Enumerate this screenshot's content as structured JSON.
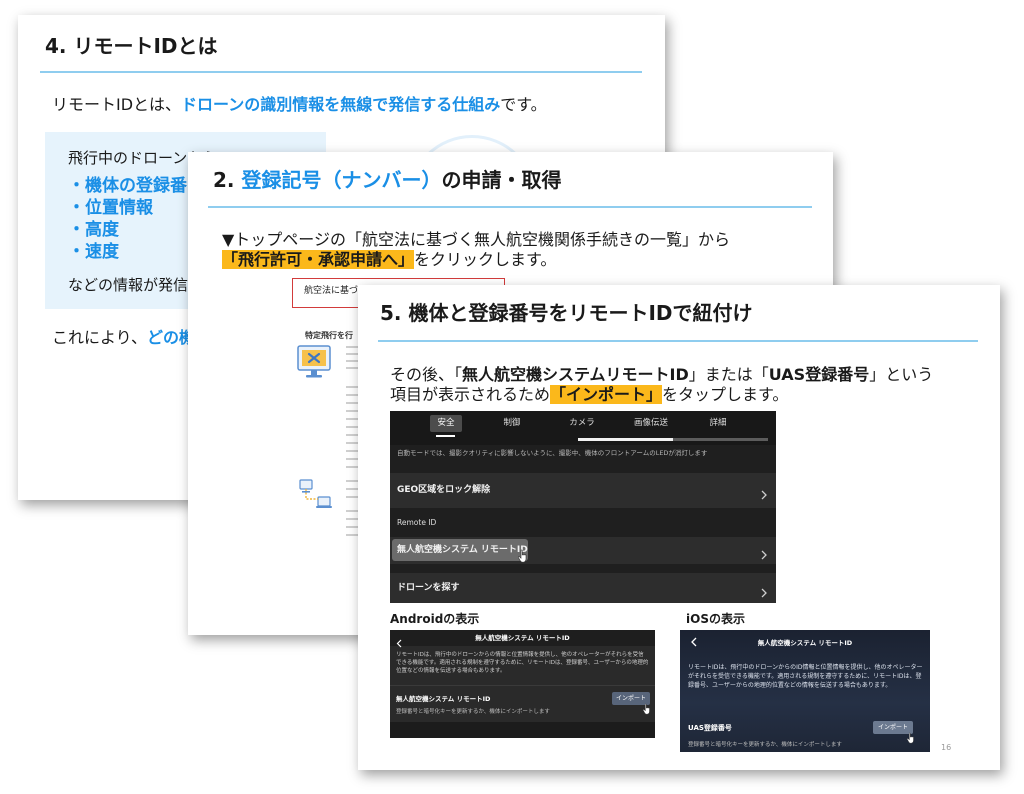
{
  "slide1": {
    "title": "4. リモートIDとは",
    "intro": {
      "pre": "リモートIDとは、",
      "em": "ドローンの識別情報を無線で発信する仕組み",
      "post": "です。"
    },
    "box": {
      "lead": "飛行中のドローンから",
      "items": [
        "・機体の登録番",
        "・位置情報",
        "・高度",
        "・速度"
      ],
      "tail": "などの情報が発信"
    },
    "outro": {
      "pre": "これにより、",
      "em": "どの機"
    }
  },
  "slide2": {
    "title": {
      "num": "2.",
      "em": "登録記号（ナンバー）",
      "post": "の申請・取得"
    },
    "line1": "▼トップページの「航空法に基づく無人航空機関係手続きの一覧」から",
    "line2": {
      "highlight": "「飛行許可・承認申請へ」",
      "post": "をクリックします。"
    },
    "website": {
      "framed_link": "航空法に基づ",
      "section_heading": "特定飛行を行",
      "icons": [
        "monitor-icon",
        "devices-icon"
      ]
    }
  },
  "slide3": {
    "title": "5. 機体と登録番号をリモートIDで紐付け",
    "line1": {
      "pre": "その後、「",
      "b1": "無人航空機システムリモートID",
      "mid": "」または「",
      "b2": "UAS登録番号",
      "post": "」という"
    },
    "line2": {
      "pre": "項目が表示されるため",
      "highlight": "「インポート」",
      "post": "をタップします。"
    },
    "app": {
      "tabs": [
        "安全",
        "制御",
        "カメラ",
        "画像伝送",
        "詳細"
      ],
      "active_tab": 0,
      "scroll_fraction": 0.5,
      "notice": "自動モードでは、撮影クオリティに影響しないように、撮影中、機体のフロントアームのLEDが消灯します",
      "section_label": "Remote ID",
      "rows": [
        {
          "label": "GEO区域をロック解除",
          "icon": "chevron-right-icon"
        },
        {
          "label": "無人航空機システム リモートID",
          "icon": "chevron-right-icon",
          "highlighted": true
        },
        {
          "label": "ドローンを探す",
          "icon": "chevron-right-icon"
        }
      ],
      "pointer_icon": "hand-pointer-icon"
    },
    "android": {
      "caption": "Androidの表示",
      "header": "無人航空機システム リモートID",
      "description": "リモートIDは、飛行中のドローンからの情報と位置情報を提供し、他のオペレーターがそれらを受信できる機能です。適用される規制を遵守するために、リモートIDは、登録番号、ユーザーからの地理的位置などの情報を伝送する場合もあります。",
      "row_title": "無人航空機システム リモートID",
      "button": "インポート",
      "row_sub": "登録番号と暗号化キーを更新するか、機体にインポートします"
    },
    "ios": {
      "caption": "iOSの表示",
      "header": "無人航空機システム リモートID",
      "description": "リモートIDは、飛行中のドローンからのID情報と位置情報を提供し、他のオペレーターがそれらを受信できる機能です。適用される規制を遵守するために、リモートIDは、登録番号、ユーザーからの地理的位置などの情報を伝送する場合もあります。",
      "row_title": "UAS登録番号",
      "button": "インポート",
      "row_sub": "登録番号と暗号化キーを更新するか、機体にインポートします"
    },
    "page_number": "16"
  },
  "colors": {
    "accent": "#1a8fe6",
    "highlight": "#fbb81b",
    "box_bg": "#e6f3fc",
    "rule": "#8fcdef",
    "red_frame": "#d23b3b"
  }
}
